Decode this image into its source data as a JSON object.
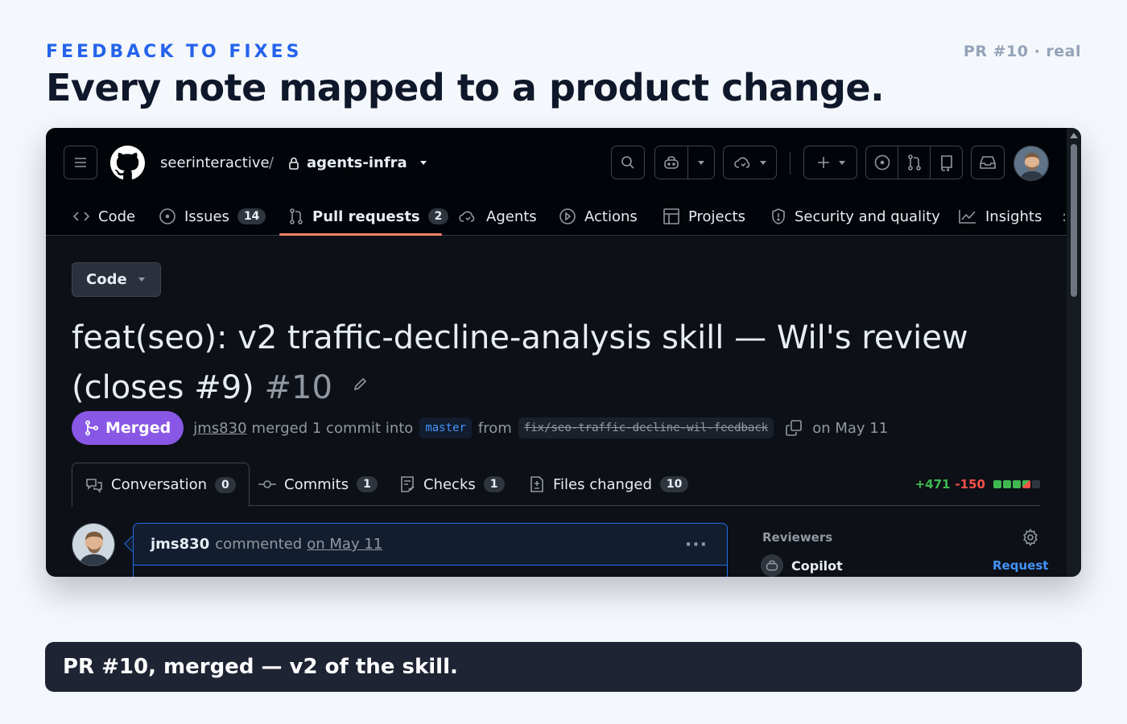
{
  "slide": {
    "eyebrow": "FEEDBACK TO FIXES",
    "badge": "PR #10 · real",
    "headline": "Every note mapped to a product change.",
    "caption": "PR #10, merged — v2 of the skill."
  },
  "github": {
    "owner": "seerinteractive",
    "separator": "/",
    "repo": "agents-infra",
    "nav": [
      {
        "label": "Code",
        "icon": "code-icon"
      },
      {
        "label": "Issues",
        "count": "14",
        "icon": "issue-icon"
      },
      {
        "label": "Pull requests",
        "count": "2",
        "icon": "pull-request-icon",
        "active": true
      },
      {
        "label": "Agents",
        "icon": "agents-icon"
      },
      {
        "label": "Actions",
        "icon": "actions-icon"
      },
      {
        "label": "Projects",
        "icon": "projects-icon"
      },
      {
        "label": "Security and quality",
        "icon": "shield-icon"
      },
      {
        "label": "Insights",
        "icon": "graph-icon"
      }
    ],
    "code_button": "Code",
    "pr": {
      "title": "feat(seo): v2 traffic-decline-analysis skill — Wil's review (closes #9)",
      "number": "#10",
      "state": "Merged",
      "author": "jms830",
      "merge_text": "merged 1 commit into",
      "base_branch": "master",
      "from_text": "from",
      "head_branch": "fix/seo-traffic-decline-wil-feedback",
      "date_text": "on May 11"
    },
    "tabs": [
      {
        "label": "Conversation",
        "count": "0"
      },
      {
        "label": "Commits",
        "count": "1"
      },
      {
        "label": "Checks",
        "count": "1"
      },
      {
        "label": "Files changed",
        "count": "10"
      }
    ],
    "diffstat": {
      "additions": "+471",
      "deletions": "-150"
    },
    "comment": {
      "author": "jms830",
      "action": "commented",
      "when": "on May 11",
      "more": "···"
    },
    "sidebar": {
      "reviewers_title": "Reviewers",
      "reviewer": "Copilot",
      "request_label": "Request"
    }
  },
  "colors": {
    "accent": "#2563eb",
    "merged": "#8957e5",
    "additions": "#3fb950",
    "deletions": "#f85149",
    "active_tab_underline": "#f78166"
  }
}
